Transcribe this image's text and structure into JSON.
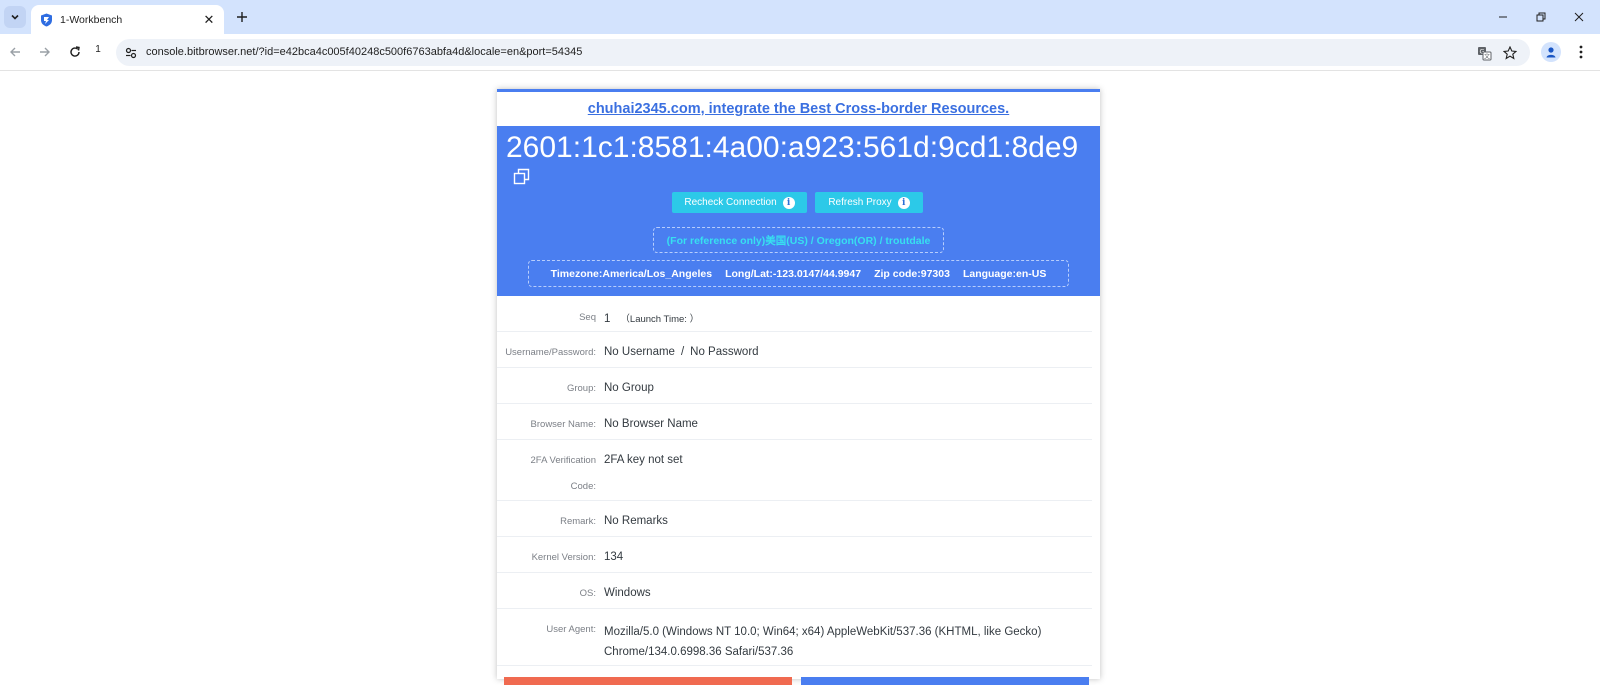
{
  "browser": {
    "tab": {
      "title": "1-Workbench"
    },
    "tab_count": "1",
    "url": "console.bitbrowser.net/?id=e42bca4c005f40248c500f6763abfa4d&locale=en&port=54345"
  },
  "promo": {
    "link_text": "chuhai2345.com, integrate the Best Cross-border Resources."
  },
  "hero": {
    "ip": "2601:1c1:8581:4a00:a923:561d:9cd1:8de9",
    "recheck_label": "Recheck Connection",
    "refresh_label": "Refresh Proxy",
    "info_glyph": "i",
    "geo": "(For reference only)美国(US) / Oregon(OR) / troutdale",
    "timezone": "Timezone:America/Los_Angeles",
    "longlat": "Long/Lat:-123.0147/44.9947",
    "zip": "Zip code:97303",
    "language": "Language:en-US"
  },
  "details": {
    "seq": {
      "label": "Seq",
      "value": "1",
      "launch": "（Launch Time: ）"
    },
    "credentials": {
      "label": "Username/Password:",
      "username": "No Username",
      "separator": "/",
      "password": "No Password"
    },
    "group": {
      "label": "Group:",
      "value": "No Group"
    },
    "browser_name": {
      "label": "Browser Name:",
      "value": "No Browser Name"
    },
    "twofa": {
      "label_line1": "2FA Verification",
      "label_line2": "Code:",
      "value": "2FA key not set"
    },
    "remark": {
      "label": "Remark:",
      "value": "No Remarks"
    },
    "kernel": {
      "label": "Kernel Version:",
      "value": "134"
    },
    "os": {
      "label": "OS:",
      "value": "Windows"
    },
    "ua": {
      "label": "User Agent:",
      "line1": "Mozilla/5.0 (Windows NT 10.0; Win64; x64) AppleWebKit/537.36 (KHTML, like Gecko)",
      "line2": "Chrome/134.0.6998.36 Safari/537.36"
    }
  },
  "colors": {
    "hero_bg": "#4a7ef0",
    "button_bg": "#2cc9e8",
    "geo_text": "#37e0f0",
    "link": "#3a6fe0"
  }
}
